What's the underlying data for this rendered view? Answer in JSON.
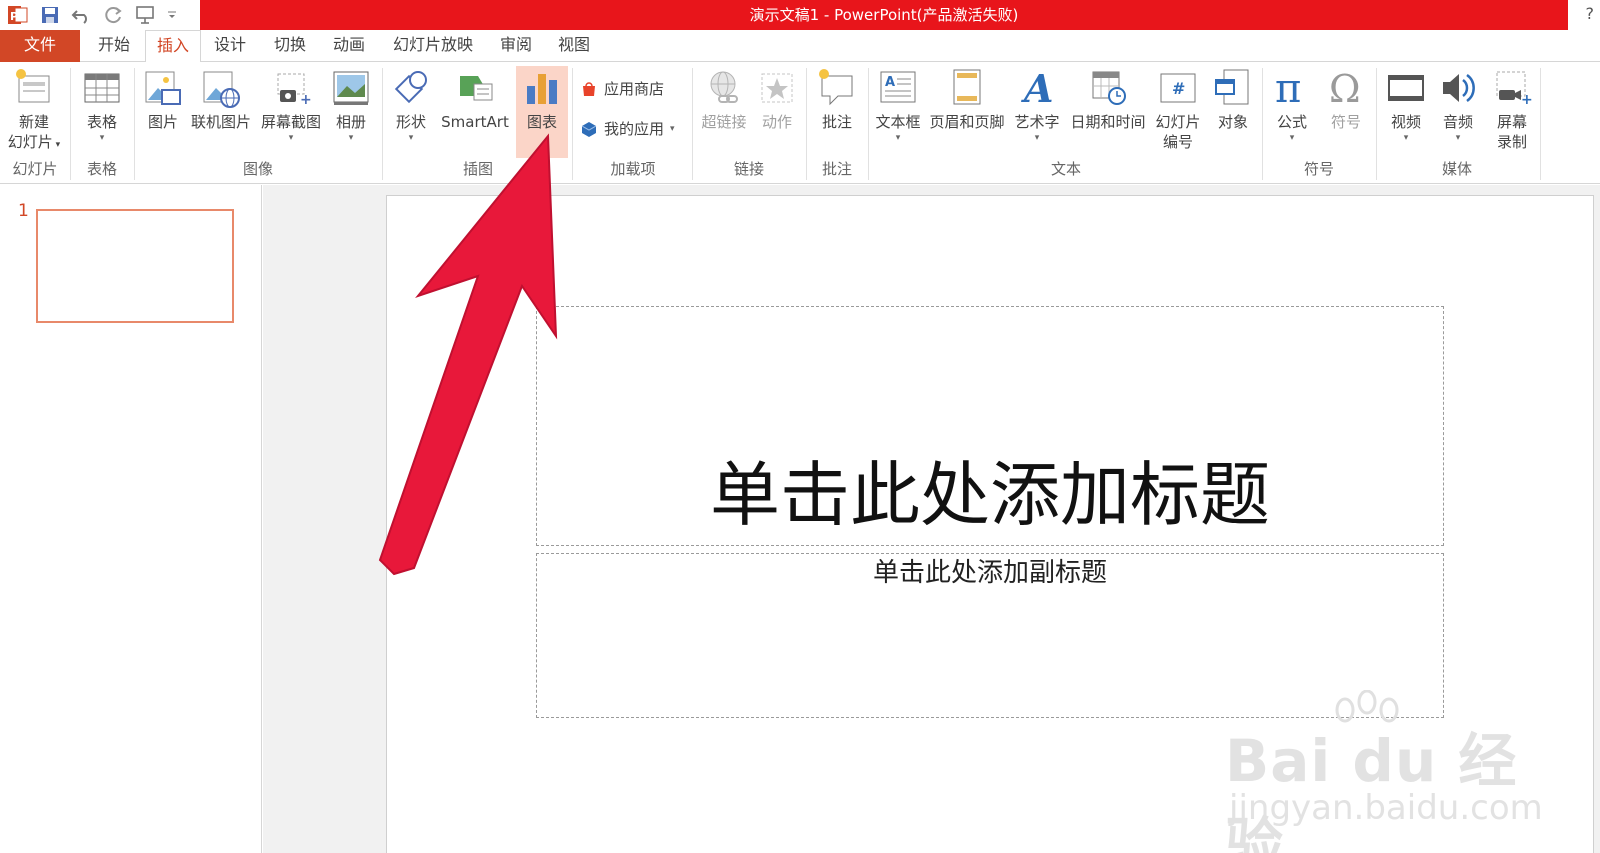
{
  "window": {
    "title": "演示文稿1 -  PowerPoint(产品激活失败)",
    "help": "?"
  },
  "qat": {
    "icons": [
      "powerpoint-logo-icon",
      "save-icon",
      "undo-icon",
      "redo-icon",
      "presenter-icon",
      "customize-qat-icon"
    ]
  },
  "tabs": {
    "file": "文件",
    "items": [
      "开始",
      "插入",
      "设计",
      "切换",
      "动画",
      "幻灯片放映",
      "审阅",
      "视图"
    ],
    "active": "插入"
  },
  "ribbon": {
    "slides": {
      "new_slide": "新建\n幻灯片",
      "new_slide_line1": "新建",
      "new_slide_line2": "幻灯片",
      "group": "幻灯片"
    },
    "tables": {
      "table": "表格",
      "group": "表格"
    },
    "images": {
      "picture": "图片",
      "online_picture": "联机图片",
      "screenshot": "屏幕截图",
      "album": "相册",
      "group": "图像"
    },
    "illustrations": {
      "shapes": "形状",
      "smartart": "SmartArt",
      "chart": "图表",
      "group": "插图"
    },
    "addins": {
      "store": "应用商店",
      "my_apps": "我的应用",
      "group": "加载项"
    },
    "links": {
      "hyperlink": "超链接",
      "action": "动作",
      "group": "链接"
    },
    "comments": {
      "comment": "批注",
      "group": "批注"
    },
    "text": {
      "textbox": "文本框",
      "header_footer": "页眉和页脚",
      "wordart": "艺术字",
      "datetime": "日期和时间",
      "slide_number_line1": "幻灯片",
      "slide_number_line2": "编号",
      "object": "对象",
      "group": "文本"
    },
    "symbols": {
      "equation": "公式",
      "symbol": "符号",
      "group": "符号"
    },
    "media": {
      "video": "视频",
      "audio": "音频",
      "screen_rec_line1": "屏幕",
      "screen_rec_line2": "录制",
      "group": "媒体"
    }
  },
  "thumbnails": {
    "slide_number": "1"
  },
  "slide": {
    "title_placeholder": "单击此处添加标题",
    "subtitle_placeholder": "单击此处添加副标题"
  },
  "watermark": {
    "brand": "Bai du 经验",
    "url": "jingyan.baidu.com"
  },
  "colors": {
    "title_bar": "#e8151b",
    "accent": "#d24726",
    "arrow": "#e8183a",
    "highlight": "#fbd5c8"
  }
}
